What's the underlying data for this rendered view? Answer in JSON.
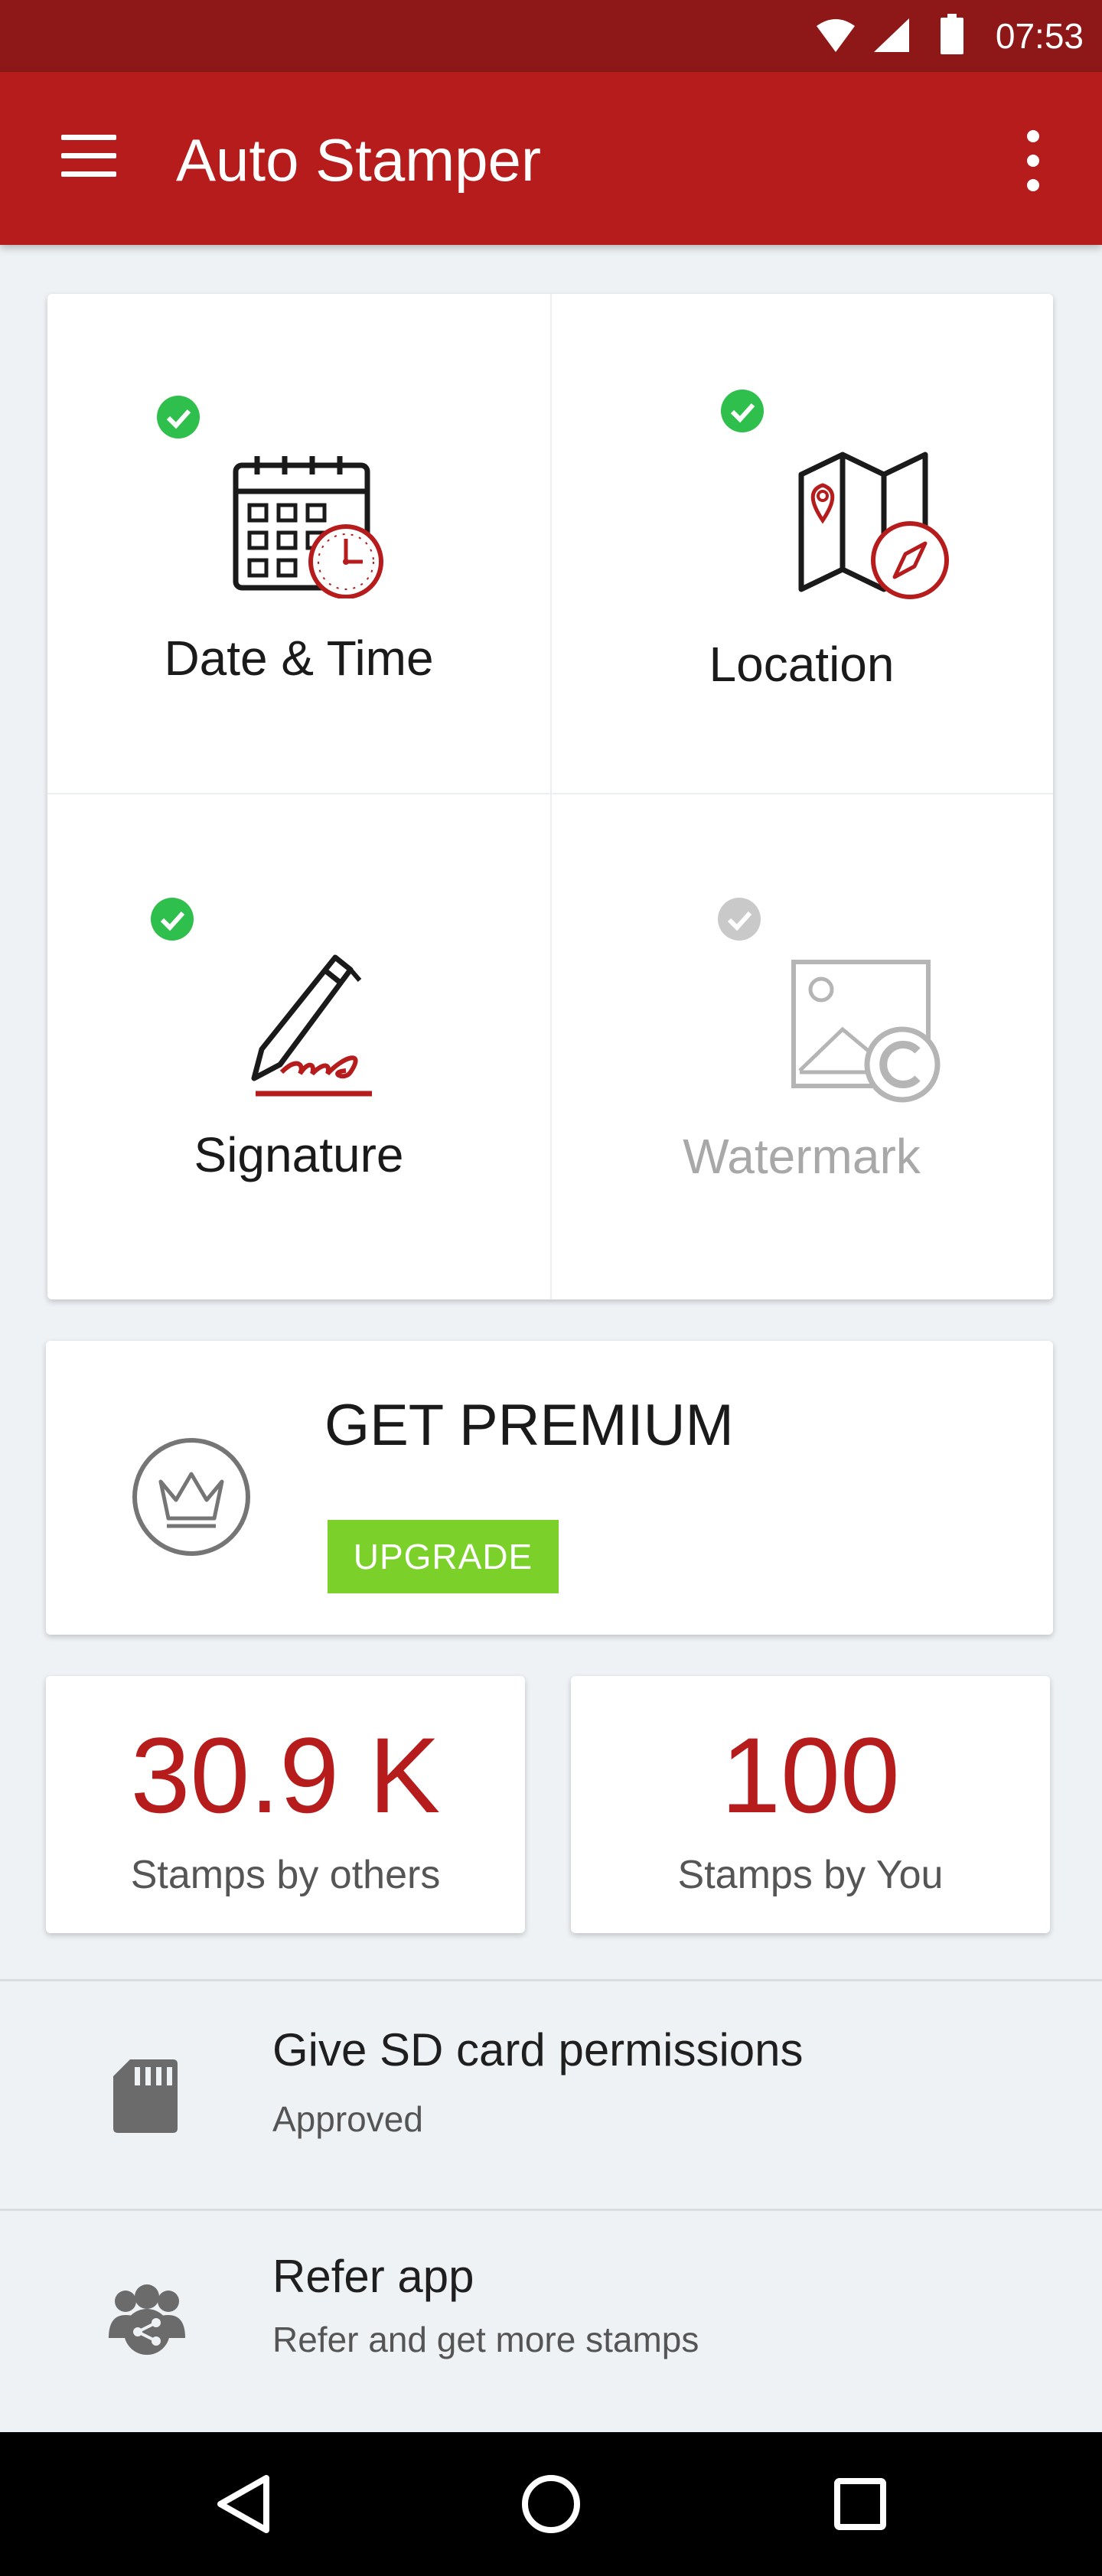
{
  "status_bar": {
    "time": "07:53",
    "icons": [
      "wifi-icon",
      "cell-signal-icon",
      "battery-icon"
    ]
  },
  "app_bar": {
    "title": "Auto Stamper",
    "menu_icon": "hamburger-menu-icon",
    "overflow_icon": "more-vert-icon"
  },
  "features": [
    {
      "label": "Date & Time",
      "icon": "calendar-clock-icon",
      "enabled": true
    },
    {
      "label": "Location",
      "icon": "map-compass-icon",
      "enabled": true
    },
    {
      "label": "Signature",
      "icon": "pen-signature-icon",
      "enabled": true
    },
    {
      "label": "Watermark",
      "icon": "image-copyright-icon",
      "enabled": false
    }
  ],
  "premium": {
    "title": "GET PREMIUM",
    "button": "UPGRADE",
    "icon": "crown-icon"
  },
  "stats": [
    {
      "value": "30.9 K",
      "label": "Stamps by others"
    },
    {
      "value": "100",
      "label": "Stamps by You"
    }
  ],
  "list": [
    {
      "title": "Give SD card permissions",
      "subtitle": "Approved",
      "icon": "sd-card-icon"
    },
    {
      "title": "Refer app",
      "subtitle": "Refer and get more stamps",
      "icon": "share-group-icon"
    }
  ],
  "nav": {
    "icons": [
      "back-icon",
      "home-icon",
      "recents-icon"
    ]
  },
  "colors": {
    "status_bar": "#8e1818",
    "primary": "#b71c1c",
    "check_active": "#2ebf4c",
    "check_inactive": "#c9c9c9",
    "upgrade": "#7bd12a",
    "background": "#eff2f5"
  }
}
